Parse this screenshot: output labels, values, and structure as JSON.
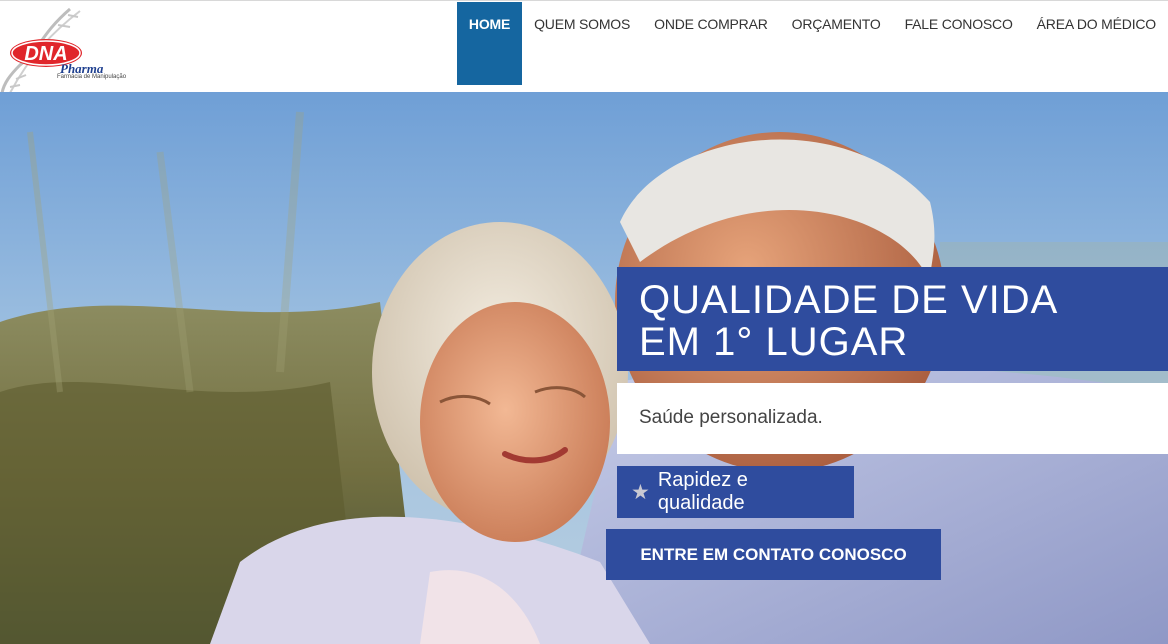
{
  "brand": {
    "logo_primary": "DNA",
    "logo_secondary": "Pharma",
    "logo_tagline": "Farmácia de Manipulação",
    "logo_red": "#e0262b",
    "logo_blue": "#1e3f8f"
  },
  "nav": {
    "items": [
      {
        "label": "HOME",
        "active": true
      },
      {
        "label": "QUEM SOMOS"
      },
      {
        "label": "ONDE COMPRAR"
      },
      {
        "label": "ORÇAMENTO"
      },
      {
        "label": "FALE CONOSCO"
      },
      {
        "label": "ÁREA DO MÉDICO"
      }
    ],
    "active_color": "#1566a0"
  },
  "hero": {
    "headline_line1": "QUALIDADE DE VIDA",
    "headline_line2": "EM 1° LUGAR",
    "subtitle": "Saúde personalizada.",
    "tag": "Rapidez e qualidade",
    "tag_icon": "star-icon",
    "cta_label": "ENTRE EM CONTATO CONOSCO",
    "accent_color": "#2f4c9e"
  }
}
